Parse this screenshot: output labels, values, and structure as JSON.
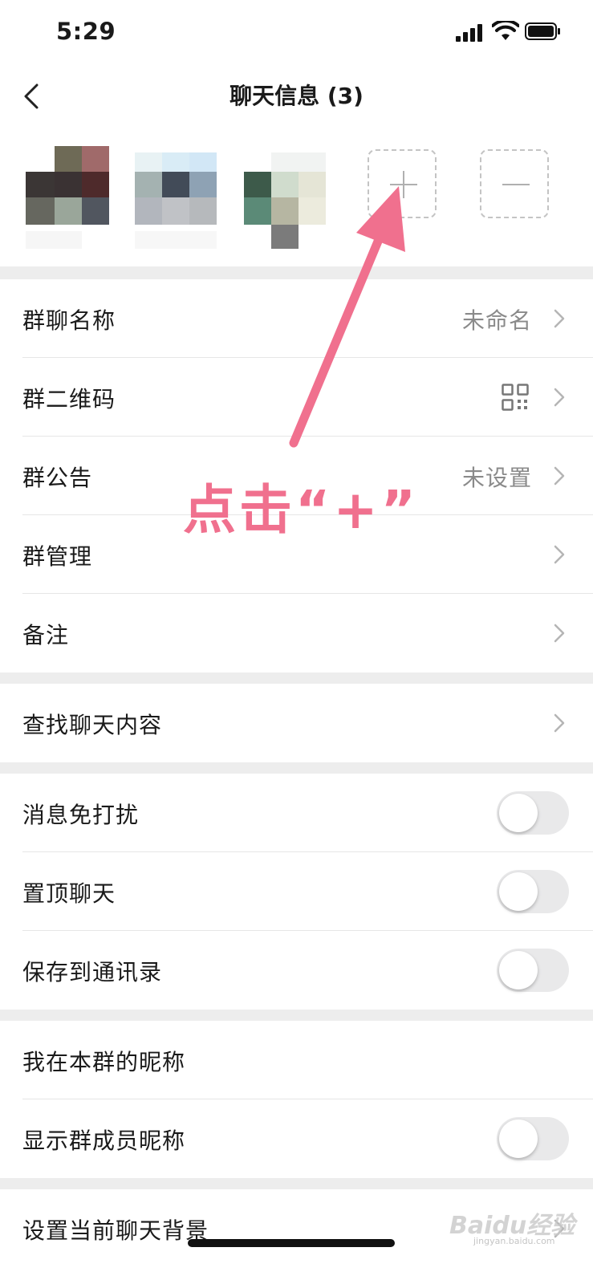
{
  "status_bar": {
    "time": "5:29"
  },
  "nav": {
    "title": "聊天信息 (3)"
  },
  "members": {
    "add_icon": "plus-icon",
    "remove_icon": "minus-icon"
  },
  "group_settings": {
    "name": {
      "label": "群聊名称",
      "value": "未命名"
    },
    "qrcode": {
      "label": "群二维码"
    },
    "notice": {
      "label": "群公告",
      "value": "未设置"
    },
    "manage": {
      "label": "群管理"
    },
    "remark": {
      "label": "备注"
    }
  },
  "search_history": {
    "label": "查找聊天内容"
  },
  "toggles": {
    "mute": {
      "label": "消息免打扰",
      "on": false
    },
    "pin": {
      "label": "置顶聊天",
      "on": false
    },
    "save_contacts": {
      "label": "保存到通讯录",
      "on": false
    }
  },
  "nickname": {
    "my_nickname": {
      "label": "我在本群的昵称"
    },
    "show_nicknames": {
      "label": "显示群成员昵称",
      "on": false
    }
  },
  "background": {
    "label": "设置当前聊天背景"
  },
  "annotation": {
    "text": "点击“+”",
    "color": "#f0708e"
  },
  "watermark": {
    "text": "Baidu经验",
    "sub": "jingyan.baidu.com"
  }
}
